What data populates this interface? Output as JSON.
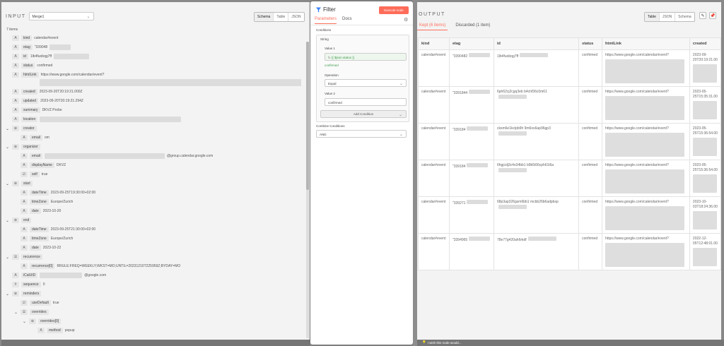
{
  "input": {
    "title": "INPUT",
    "node_select": "Merge1",
    "view_tabs": [
      "Schema",
      "Table",
      "JSON"
    ],
    "active_view": "Schema",
    "items_count": "7 items",
    "fields": [
      {
        "type": "A",
        "key": "kind",
        "value": "calendar#event"
      },
      {
        "type": "A",
        "key": "etag",
        "value": "\"339048"
      },
      {
        "type": "A",
        "key": "id",
        "value": "1lb4fuobqg7ff"
      },
      {
        "type": "A",
        "key": "status",
        "value": "confirmed"
      },
      {
        "type": "A",
        "key": "htmlLink",
        "value": "https://www.google.com/calendar/event?"
      },
      {
        "type": "A",
        "key": "created",
        "value": "2023-09-20T20:19:21.000Z"
      },
      {
        "type": "A",
        "key": "updated",
        "value": "2023-09-20T20:19:21.294Z"
      },
      {
        "type": "A",
        "key": "summary",
        "value": "DKVZ Probe"
      },
      {
        "type": "A",
        "key": "location",
        "value": ""
      },
      {
        "type": "obj",
        "key": "creator",
        "value": ""
      },
      {
        "type": "A",
        "key": "email",
        "value": "om"
      },
      {
        "type": "obj",
        "key": "organizer",
        "value": ""
      },
      {
        "type": "A",
        "key": "email",
        "value": "@group.calendar.google.com"
      },
      {
        "type": "A",
        "key": "displayName",
        "value": "DKVZ"
      },
      {
        "type": "bool",
        "key": "self",
        "value": "true"
      },
      {
        "type": "obj",
        "key": "start",
        "value": ""
      },
      {
        "type": "A",
        "key": "dateTime",
        "value": "2023-09-25T19:30:00+02:00"
      },
      {
        "type": "A",
        "key": "timeZone",
        "value": "Europe/Zurich"
      },
      {
        "type": "A",
        "key": "date",
        "value": "2023-10-20"
      },
      {
        "type": "obj",
        "key": "end",
        "value": ""
      },
      {
        "type": "A",
        "key": "dateTime",
        "value": "2023-09-25T21:30:00+02:00"
      },
      {
        "type": "A",
        "key": "timeZone",
        "value": "Europe/Zurich"
      },
      {
        "type": "A",
        "key": "date",
        "value": "2023-10-22"
      },
      {
        "type": "arr",
        "key": "recurrence",
        "value": ""
      },
      {
        "type": "A",
        "key": "recurrence[0]",
        "value": "RRULE:FREQ=WEEKLY;WKST=MO;UNTIL=20231210T225959Z;BYDAY=MO"
      },
      {
        "type": "A",
        "key": "iCalUID",
        "value": "@google.com"
      },
      {
        "type": "#",
        "key": "sequence",
        "value": "0"
      },
      {
        "type": "obj",
        "key": "reminders",
        "value": ""
      },
      {
        "type": "bool",
        "key": "useDefault",
        "value": "true"
      },
      {
        "type": "arr",
        "key": "overrides",
        "value": ""
      },
      {
        "type": "obj",
        "key": "overrides[0]",
        "value": ""
      },
      {
        "type": "A",
        "key": "method",
        "value": "popup"
      }
    ]
  },
  "modal": {
    "title": "Filter",
    "execute_label": "Execute node",
    "tabs": [
      "Parameters",
      "Docs"
    ],
    "conditions_label": "Conditions",
    "string_label": "String",
    "value1_label": "Value 1",
    "value1_expr": "{{ $json.status }}",
    "value1_result": "confirmed",
    "operation_label": "Operation",
    "operation_value": "Equal",
    "value2_label": "Value 2",
    "value2_value": "confirmed",
    "add_condition_label": "Add Condition",
    "combine_label": "Combine Conditions",
    "combine_value": "AND"
  },
  "output": {
    "title": "OUTPUT",
    "view_tabs": [
      "Table",
      "JSON",
      "Schema"
    ],
    "active_view": "Table",
    "tabs": [
      "Kept (6 items)",
      "Discarded (1 item)"
    ],
    "columns": [
      "kind",
      "etag",
      "id",
      "status",
      "htmlLink",
      "created"
    ],
    "rows": [
      {
        "kind": "calendar#event",
        "etag": "\"3390482",
        "id": "1lb4fuobqg7ff",
        "status": "confirmed",
        "htmlLink": "https://www.google.com/calendar/event?",
        "created": "2023-09-20T20:19:21.00"
      },
      {
        "kind": "calendar#event",
        "etag": "\"3391844",
        "id": "6ph62cj2cgq3eb b4chf36c0m61",
        "status": "confirmed",
        "htmlLink": "https://www.google.com/calendar/event?",
        "created": "2023-05-25T15:35:31.00"
      },
      {
        "kind": "calendar#event",
        "etag": "\"339184",
        "id": "cksm6e1kclpb9h 9m6os6ap96gp3",
        "status": "confirmed",
        "htmlLink": "https://www.google.com/calendar/event?",
        "created": "2023-05-25T15:36:54.00"
      },
      {
        "kind": "calendar#event",
        "etag": "\"339184",
        "id": "6hgjcdj3c4o34bb1 b9b5i66cph61i6a",
        "status": "confirmed",
        "htmlLink": "https://www.google.com/calendar/event?",
        "created": "2023-05-25T15:36:54.00"
      },
      {
        "kind": "calendar#event",
        "etag": "\"339271",
        "id": "68p3ap326gsm6bb1 mcbb26b6adpbsp",
        "status": "confirmed",
        "htmlLink": "https://www.google.com/calendar/event?",
        "created": "2023-10-03T18:24:36.00"
      },
      {
        "kind": "calendar#event",
        "etag": "\"3394965",
        "id": "78e77g420ah6rkdf",
        "status": "confirmed",
        "htmlLink": "https://www.google.com/calendar/event?",
        "created": "2022-12-05T12:48:01.00"
      }
    ],
    "wish_label": "I wish this node would..."
  },
  "colors": {
    "accent": "#ff6d5a",
    "expr_green": "#3e9c4b"
  }
}
